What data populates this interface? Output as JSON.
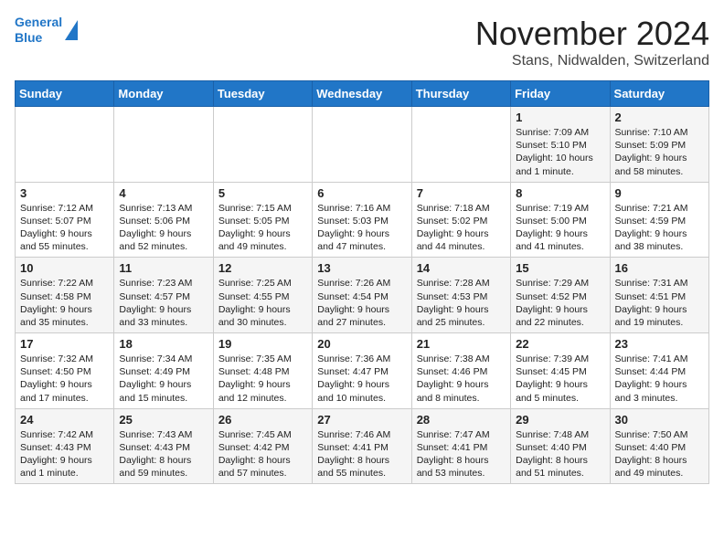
{
  "header": {
    "logo_line1": "General",
    "logo_line2": "Blue",
    "month": "November 2024",
    "location": "Stans, Nidwalden, Switzerland"
  },
  "weekdays": [
    "Sunday",
    "Monday",
    "Tuesday",
    "Wednesday",
    "Thursday",
    "Friday",
    "Saturday"
  ],
  "weeks": [
    [
      {
        "day": "",
        "info": ""
      },
      {
        "day": "",
        "info": ""
      },
      {
        "day": "",
        "info": ""
      },
      {
        "day": "",
        "info": ""
      },
      {
        "day": "",
        "info": ""
      },
      {
        "day": "1",
        "info": "Sunrise: 7:09 AM\nSunset: 5:10 PM\nDaylight: 10 hours and 1 minute."
      },
      {
        "day": "2",
        "info": "Sunrise: 7:10 AM\nSunset: 5:09 PM\nDaylight: 9 hours and 58 minutes."
      }
    ],
    [
      {
        "day": "3",
        "info": "Sunrise: 7:12 AM\nSunset: 5:07 PM\nDaylight: 9 hours and 55 minutes."
      },
      {
        "day": "4",
        "info": "Sunrise: 7:13 AM\nSunset: 5:06 PM\nDaylight: 9 hours and 52 minutes."
      },
      {
        "day": "5",
        "info": "Sunrise: 7:15 AM\nSunset: 5:05 PM\nDaylight: 9 hours and 49 minutes."
      },
      {
        "day": "6",
        "info": "Sunrise: 7:16 AM\nSunset: 5:03 PM\nDaylight: 9 hours and 47 minutes."
      },
      {
        "day": "7",
        "info": "Sunrise: 7:18 AM\nSunset: 5:02 PM\nDaylight: 9 hours and 44 minutes."
      },
      {
        "day": "8",
        "info": "Sunrise: 7:19 AM\nSunset: 5:00 PM\nDaylight: 9 hours and 41 minutes."
      },
      {
        "day": "9",
        "info": "Sunrise: 7:21 AM\nSunset: 4:59 PM\nDaylight: 9 hours and 38 minutes."
      }
    ],
    [
      {
        "day": "10",
        "info": "Sunrise: 7:22 AM\nSunset: 4:58 PM\nDaylight: 9 hours and 35 minutes."
      },
      {
        "day": "11",
        "info": "Sunrise: 7:23 AM\nSunset: 4:57 PM\nDaylight: 9 hours and 33 minutes."
      },
      {
        "day": "12",
        "info": "Sunrise: 7:25 AM\nSunset: 4:55 PM\nDaylight: 9 hours and 30 minutes."
      },
      {
        "day": "13",
        "info": "Sunrise: 7:26 AM\nSunset: 4:54 PM\nDaylight: 9 hours and 27 minutes."
      },
      {
        "day": "14",
        "info": "Sunrise: 7:28 AM\nSunset: 4:53 PM\nDaylight: 9 hours and 25 minutes."
      },
      {
        "day": "15",
        "info": "Sunrise: 7:29 AM\nSunset: 4:52 PM\nDaylight: 9 hours and 22 minutes."
      },
      {
        "day": "16",
        "info": "Sunrise: 7:31 AM\nSunset: 4:51 PM\nDaylight: 9 hours and 19 minutes."
      }
    ],
    [
      {
        "day": "17",
        "info": "Sunrise: 7:32 AM\nSunset: 4:50 PM\nDaylight: 9 hours and 17 minutes."
      },
      {
        "day": "18",
        "info": "Sunrise: 7:34 AM\nSunset: 4:49 PM\nDaylight: 9 hours and 15 minutes."
      },
      {
        "day": "19",
        "info": "Sunrise: 7:35 AM\nSunset: 4:48 PM\nDaylight: 9 hours and 12 minutes."
      },
      {
        "day": "20",
        "info": "Sunrise: 7:36 AM\nSunset: 4:47 PM\nDaylight: 9 hours and 10 minutes."
      },
      {
        "day": "21",
        "info": "Sunrise: 7:38 AM\nSunset: 4:46 PM\nDaylight: 9 hours and 8 minutes."
      },
      {
        "day": "22",
        "info": "Sunrise: 7:39 AM\nSunset: 4:45 PM\nDaylight: 9 hours and 5 minutes."
      },
      {
        "day": "23",
        "info": "Sunrise: 7:41 AM\nSunset: 4:44 PM\nDaylight: 9 hours and 3 minutes."
      }
    ],
    [
      {
        "day": "24",
        "info": "Sunrise: 7:42 AM\nSunset: 4:43 PM\nDaylight: 9 hours and 1 minute."
      },
      {
        "day": "25",
        "info": "Sunrise: 7:43 AM\nSunset: 4:43 PM\nDaylight: 8 hours and 59 minutes."
      },
      {
        "day": "26",
        "info": "Sunrise: 7:45 AM\nSunset: 4:42 PM\nDaylight: 8 hours and 57 minutes."
      },
      {
        "day": "27",
        "info": "Sunrise: 7:46 AM\nSunset: 4:41 PM\nDaylight: 8 hours and 55 minutes."
      },
      {
        "day": "28",
        "info": "Sunrise: 7:47 AM\nSunset: 4:41 PM\nDaylight: 8 hours and 53 minutes."
      },
      {
        "day": "29",
        "info": "Sunrise: 7:48 AM\nSunset: 4:40 PM\nDaylight: 8 hours and 51 minutes."
      },
      {
        "day": "30",
        "info": "Sunrise: 7:50 AM\nSunset: 4:40 PM\nDaylight: 8 hours and 49 minutes."
      }
    ]
  ]
}
